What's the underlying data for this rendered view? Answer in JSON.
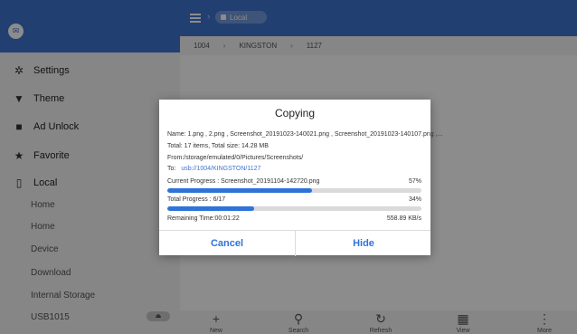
{
  "sidebar": {
    "items": [
      {
        "icon": "gear-icon",
        "label": "Settings"
      },
      {
        "icon": "shirt-icon",
        "label": "Theme"
      },
      {
        "icon": "lock-icon",
        "label": "Ad Unlock"
      },
      {
        "icon": "star-icon",
        "label": "Favorite"
      },
      {
        "icon": "phone-icon",
        "label": "Local"
      }
    ],
    "sub_items": [
      "Home",
      "Home",
      "Device",
      "Download",
      "Internal Storage",
      "USB1015"
    ]
  },
  "topbar": {
    "location_chip": "Local"
  },
  "breadcrumb": [
    "1004",
    "KINGSTON",
    "1127"
  ],
  "bottom_bar": [
    {
      "icon": "plus-icon",
      "label": "New"
    },
    {
      "icon": "search-icon",
      "label": "Search"
    },
    {
      "icon": "refresh-icon",
      "label": "Refresh"
    },
    {
      "icon": "grid-icon",
      "label": "View"
    },
    {
      "icon": "more-icon",
      "label": "More"
    }
  ],
  "dialog": {
    "title": "Copying",
    "name_line": "Name: 1.png , 2.png , Screenshot_20191023-140021.png , Screenshot_20191023-140107.png ,...",
    "total_line": "Total: 17 items, Total size: 14.28 MB",
    "from_line": "From:/storage/emulated/0/Pictures/Screenshots/",
    "to_label": "To:",
    "to_path": "usb://1004/KINGSTON/1127",
    "current_label": "Current Progress : Screenshot_20191104-142720.png",
    "current_percent": "57%",
    "current_fraction": 0.57,
    "total_label": "Total Progress : 6/17",
    "total_percent": "34%",
    "total_fraction": 0.34,
    "remaining": "Remaining Time:00:01:22",
    "speed": "558.89 KB/s",
    "cancel_label": "Cancel",
    "hide_label": "Hide"
  },
  "colors": {
    "accent": "#3e74cf",
    "progress": "#2f73d8"
  }
}
